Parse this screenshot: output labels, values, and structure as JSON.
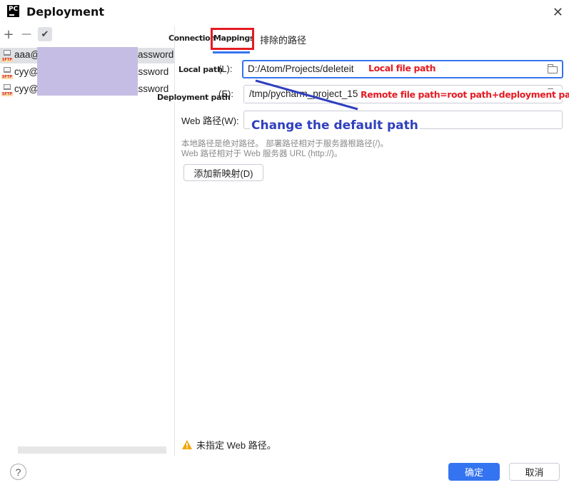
{
  "window": {
    "app_icon_text": "PC",
    "title": "Deployment",
    "close_glyph": "✕"
  },
  "toolbar": {
    "add_glyph": "+",
    "remove_glyph": "—",
    "apply_glyph": "✔"
  },
  "servers": [
    {
      "name": "aaa@",
      "suffix": "assword",
      "icon": "sftp-icon",
      "selected": true
    },
    {
      "name": "cyy@",
      "suffix": "assword",
      "icon": "sftp-icon",
      "selected": false
    },
    {
      "name": "cyy@",
      "suffix": "assword",
      "icon": "sftp-icon",
      "selected": false
    }
  ],
  "sftp_icon_label": "SFTP",
  "tabs": [
    {
      "label": "Connection"
    },
    {
      "label": "Mappings",
      "active": true
    },
    {
      "label": "排除的路径"
    }
  ],
  "mappings": {
    "local_path_label": "Local path",
    "local_path_mnemonic": "(L):",
    "local_path_value": "D:/Atom/Projects/deleteit",
    "deployment_path_label": "Deployment path",
    "deployment_path_mnemonic": "(E):",
    "deployment_path_value": "/tmp/pycharm_project_15",
    "web_path_label": "Web 路径(W):",
    "hint_line1": "本地路径是绝对路径。 部署路径相对于服务器根路径(/)。",
    "hint_line2": "Web 路径相对于 Web 服务器 URL (http://)。",
    "add_mapping_button": "添加新映射(D)"
  },
  "annotations": {
    "local_file_path": "Local file path",
    "remote_file_path": "Remote file path=root path+deployment path",
    "change_default": "Change the default path"
  },
  "warning": {
    "icon": "warning-icon",
    "text": "未指定 Web 路径。"
  },
  "footer": {
    "help_glyph": "?",
    "ok_label": "确定",
    "cancel_label": "取消"
  },
  "colors": {
    "accent": "#3574f0",
    "annotation_red": "#e41b23",
    "annotation_blue": "#2f3fbf",
    "redaction": "#c5bde3",
    "warning": "#f2a60c"
  }
}
